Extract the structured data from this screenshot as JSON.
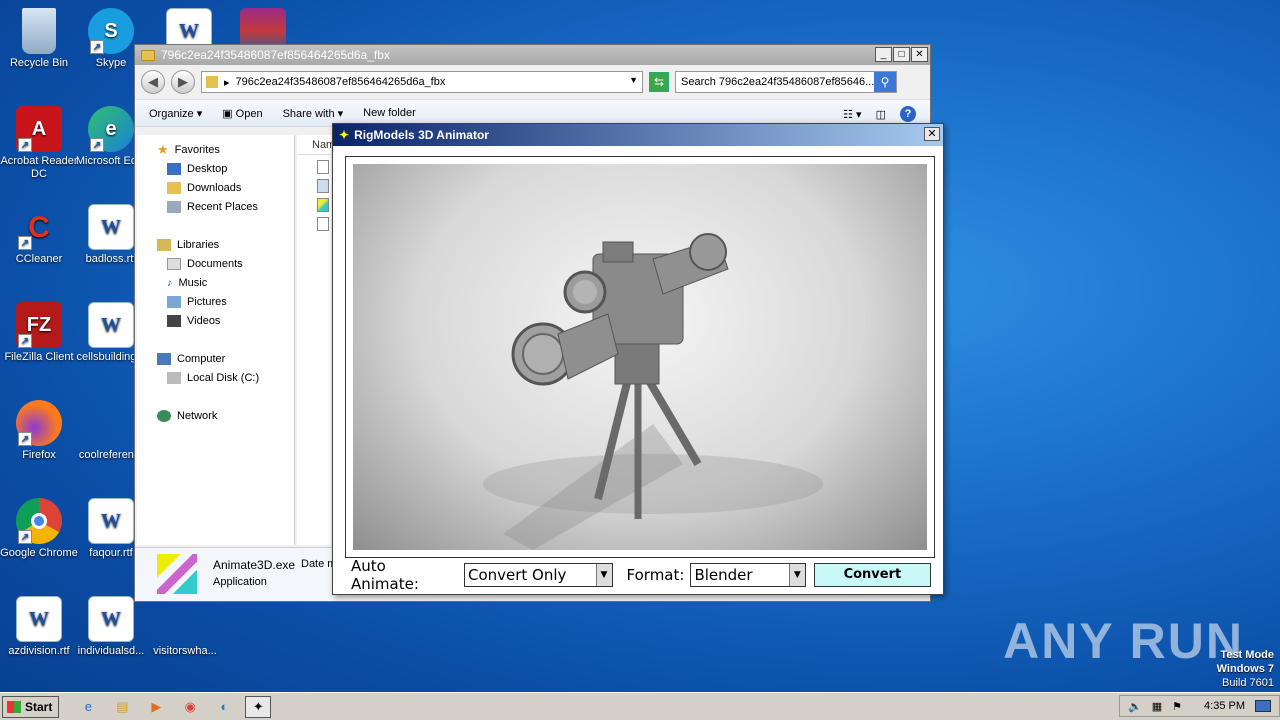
{
  "desktop": {
    "icons": [
      {
        "label": "Recycle Bin"
      },
      {
        "label": "Skype"
      },
      {
        "label": "Acrobat Reader DC"
      },
      {
        "label": "Microsoft Ed..."
      },
      {
        "label": "CCleaner"
      },
      {
        "label": "badloss.rtf"
      },
      {
        "label": "FileZilla Client"
      },
      {
        "label": "cellsbuilding..."
      },
      {
        "label": "Firefox"
      },
      {
        "label": "coolreferen..."
      },
      {
        "label": "Google Chrome"
      },
      {
        "label": "faqour.rtf"
      },
      {
        "label": "azdivision.rtf"
      },
      {
        "label": "individualsd..."
      },
      {
        "label": "visitorswha..."
      }
    ],
    "watermark": "ANY RUN",
    "testmode": {
      "line1": "Test Mode",
      "line2": "Windows 7",
      "line3": "Build 7601"
    }
  },
  "explorer": {
    "title": "796c2ea24f35486087ef856464265d6a_fbx",
    "address": "796c2ea24f35486087ef856464265d6a_fbx",
    "search_placeholder": "Search 796c2ea24f35486087ef85646...",
    "toolbar": {
      "organize": "Organize",
      "open": "Open",
      "share_with": "Share with",
      "new_folder": "New folder"
    },
    "nav": {
      "favorites": "Favorites",
      "desktop": "Desktop",
      "downloads": "Downloads",
      "recent": "Recent Places",
      "libraries": "Libraries",
      "documents": "Documents",
      "music": "Music",
      "pictures": "Pictures",
      "videos": "Videos",
      "computer": "Computer",
      "local_disk": "Local Disk (C:)",
      "network": "Network"
    },
    "column_name": "Nam",
    "details": {
      "name": "Animate3D.exe",
      "type": "Application",
      "date_modified": "Date m"
    }
  },
  "animator": {
    "title": "RigModels 3D Animator",
    "auto_animate_label": "Auto Animate:",
    "auto_animate_value": "Convert Only",
    "format_label": "Format:",
    "format_value": "Blender",
    "convert_label": "Convert"
  },
  "taskbar": {
    "start": "Start",
    "time": "4:35 PM"
  }
}
